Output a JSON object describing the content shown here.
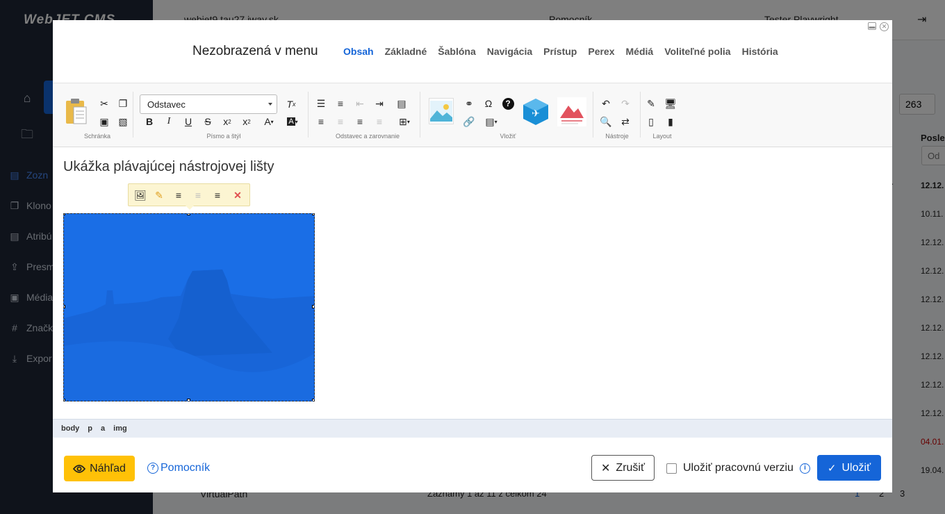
{
  "app": {
    "logo": "WebJET CMS",
    "domain_select": "webjet9.tau27.iway.sk",
    "help": "Pomocník",
    "user": "Tester Playwright",
    "sidebar": [
      "Zozn",
      "Klono",
      "Atribú",
      "Presm",
      "Média",
      "Značk",
      "Expor"
    ],
    "page_size_value": "263",
    "col_header": "Posled",
    "filter_placeholder": "Od",
    "col_short": "or",
    "right_dates": [
      "12.12.",
      "10.11.",
      "12.12.",
      "12.12.",
      "12.12.",
      "12.12.",
      "12.12.",
      "12.12.",
      "12.12.",
      "04.01.",
      "19.04."
    ],
    "tree_item_1": "VirtualPath",
    "records_info": "Záznamy 1 až 11 z celkom 24",
    "pages": [
      "1",
      "2",
      "3"
    ]
  },
  "modal": {
    "title": "Nezobrazená v menu",
    "tabs": [
      "Obsah",
      "Základné",
      "Šablóna",
      "Navigácia",
      "Prístup",
      "Perex",
      "Médiá",
      "Voliteľné polia",
      "História"
    ],
    "toolbar": {
      "groups": [
        "Schránka",
        "Písmo a štýl",
        "Odstavec a zarovnanie",
        "Vložiť",
        "Nástroje",
        "Layout"
      ],
      "format_select": "Odstavec"
    },
    "editor": {
      "heading": "Ukážka plávajúcej nástrojovej lišty"
    },
    "path": [
      "body",
      "p",
      "a",
      "img"
    ],
    "footer": {
      "preview": "Náhľad",
      "help": "Pomocník",
      "cancel": "Zrušiť",
      "save_draft": "Uložiť pracovnú verziu",
      "save": "Uložiť"
    }
  }
}
